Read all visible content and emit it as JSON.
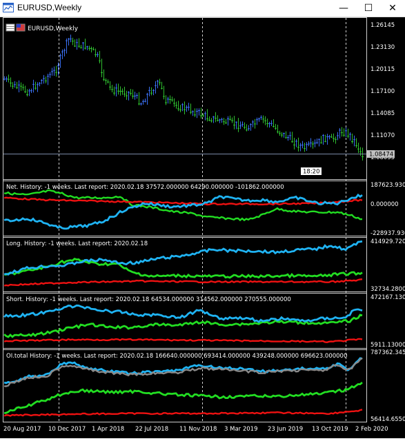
{
  "window": {
    "title": "EURUSD,Weekly",
    "minimize_glyph": "—",
    "maximize_glyph": "☐",
    "close_glyph": "✕"
  },
  "colors": {
    "background": "#000000",
    "bull_candle": "#3a6ff0",
    "bear_candle": "#2fbf2f",
    "series_blue": "#1fb3f3",
    "series_green": "#22dd22",
    "series_red": "#ee1111",
    "series_gray": "#8a8a8a",
    "separator": "#cfcfcf",
    "axis_text": "#ffffff"
  },
  "main_panel": {
    "symbol_label": "EURUSD,Weekly",
    "price_ticks": [
      "1.26145",
      "1.23130",
      "1.20115",
      "1.17100",
      "1.14085",
      "1.11070",
      "1.08055"
    ],
    "current_price": "1.08474",
    "time_marker": "18:20"
  },
  "indicator_panels": [
    {
      "label": "Net. History: -1 weeks. Last report: 2020.02.18      37572.000000  64290.000000  -101862.000000",
      "y_top": "187623.930",
      "y_mid": "0.000000",
      "y_bottom": "-228937.930"
    },
    {
      "label": "Long. History: -1 weeks. Last report: 2020.02.18",
      "y_top": "414929.720",
      "y_bottom": "32734.2800"
    },
    {
      "label": "Short. History: -1 weeks. Last report: 2020.02.18      64534.000000  314562.000000  270555.000000",
      "y_top": "472167.130",
      "y_bottom": "5911.13000"
    },
    {
      "label": "OI.total History: -1 weeks. Last report: 2020.02.18      166640.000000  693414.000000  439248.000000  696623.000000",
      "y_top": "787362.345",
      "y_bottom": "56414.6550"
    }
  ],
  "time_axis": [
    "20 Aug 2017",
    "10 Dec 2017",
    "1 Apr 2018",
    "22 Jul 2018",
    "11 Nov 2018",
    "3 Mar 2019",
    "23 Jun 2019",
    "13 Oct 2019",
    "2 Feb 2020"
  ]
}
